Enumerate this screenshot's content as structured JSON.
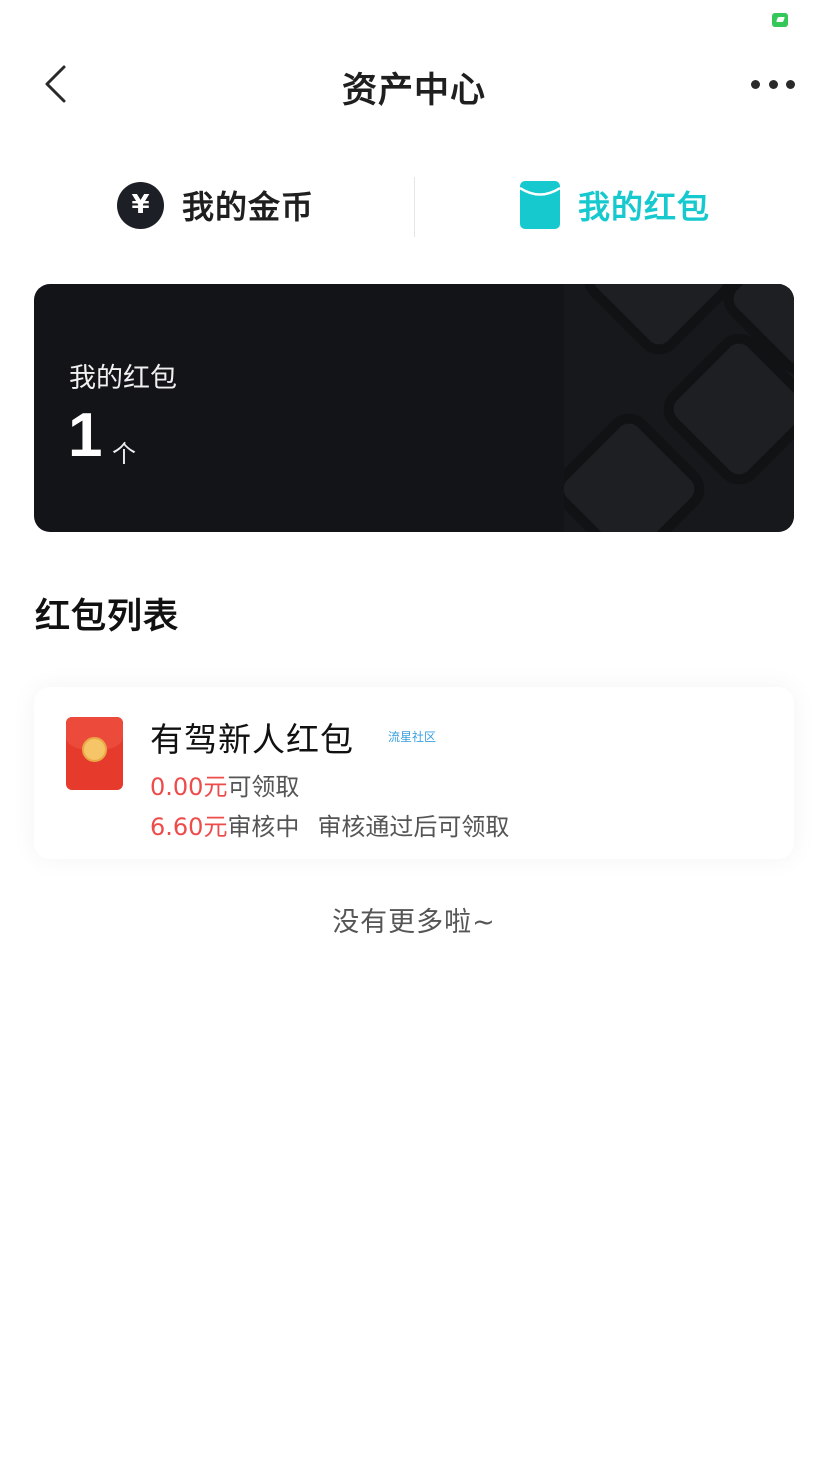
{
  "nav": {
    "title": "资产中心"
  },
  "tabs": {
    "coin_label": "我的金币",
    "coin_symbol": "¥",
    "hongbao_label": "我的红包",
    "active_color": "#16c9cf"
  },
  "summary": {
    "label": "我的红包",
    "count": "1",
    "unit": "个"
  },
  "list": {
    "title": "红包列表",
    "items": [
      {
        "title": "有驾新人红包",
        "source": "流星社区",
        "claimable_amount": "0.00元",
        "claimable_status": "可领取",
        "pending_amount": "6.60元",
        "pending_status": "审核中",
        "pending_note": "审核通过后可领取"
      }
    ]
  },
  "footer": {
    "end_text": "没有更多啦~"
  }
}
